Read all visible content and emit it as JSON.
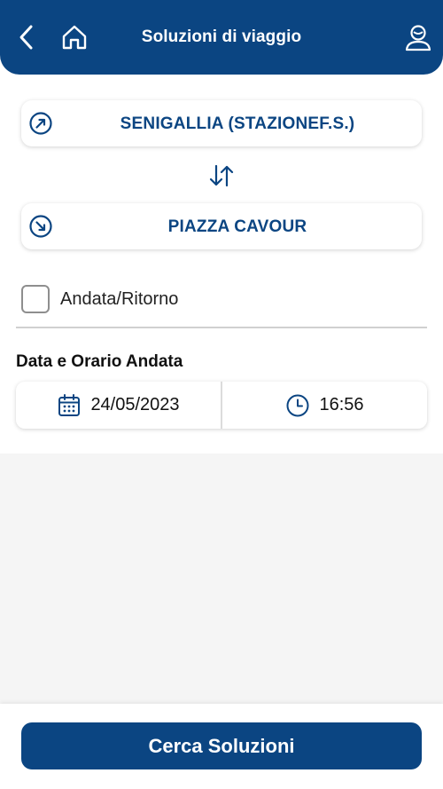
{
  "header": {
    "title": "Soluzioni di viaggio",
    "back_icon": "chevron-left-icon",
    "home_icon": "home-icon",
    "user_icon": "user-icon"
  },
  "route": {
    "from": {
      "label": "SENIGALLIA (STAZIONEF.S.)",
      "icon": "arrow-up-right-circle-icon"
    },
    "swap_icon": "swap-vertical-icon",
    "to": {
      "label": "PIAZZA CAVOUR",
      "icon": "arrow-down-right-circle-icon"
    }
  },
  "round_trip": {
    "label": "Andata/Ritorno",
    "checked": false
  },
  "departure": {
    "title": "Data e Orario Andata",
    "date": "24/05/2023",
    "time": "16:56",
    "date_icon": "calendar-icon",
    "time_icon": "clock-icon"
  },
  "search_button": {
    "label": "Cerca Soluzioni"
  },
  "colors": {
    "primary": "#0b4582",
    "background_gray": "#f5f5f5"
  }
}
